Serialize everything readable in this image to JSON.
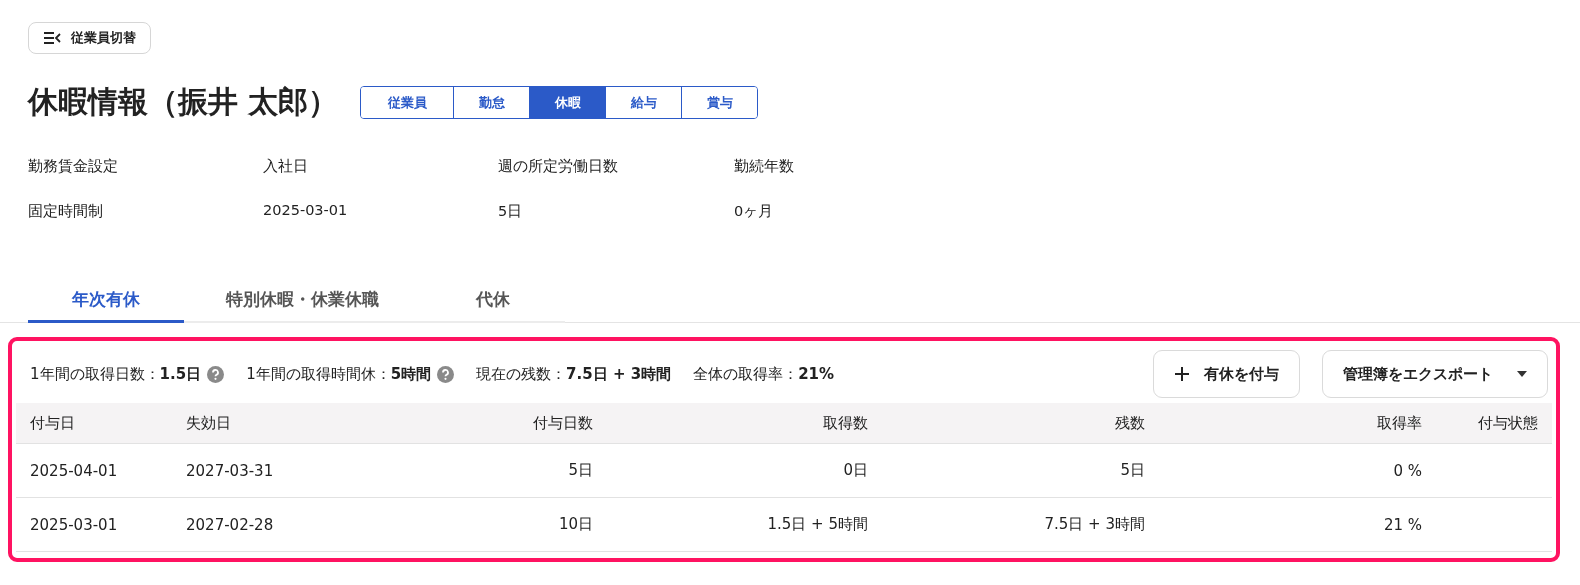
{
  "switch_button": {
    "label": "従業員切替"
  },
  "page_title": "休暇情報（振井 太郎）",
  "section_tabs": [
    {
      "label": "従業員",
      "selected": false
    },
    {
      "label": "勤怠",
      "selected": false
    },
    {
      "label": "休暇",
      "selected": true
    },
    {
      "label": "給与",
      "selected": false
    },
    {
      "label": "賞与",
      "selected": false
    }
  ],
  "info": [
    {
      "label": "勤務賃金設定",
      "value": "固定時間制"
    },
    {
      "label": "入社日",
      "value": "2025-03-01"
    },
    {
      "label": "週の所定労働日数",
      "value": "5日"
    },
    {
      "label": "勤続年数",
      "value": "0ヶ月"
    }
  ],
  "leave_tabs": [
    {
      "label": "年次有休",
      "selected": true
    },
    {
      "label": "特別休暇・休業休職",
      "selected": false
    },
    {
      "label": "代休",
      "selected": false
    }
  ],
  "summary": [
    {
      "text": "1年間の取得日数：**1.5日**",
      "help": true
    },
    {
      "text": "1年間の取得時間休：**5時間**",
      "help": true
    },
    {
      "text": "現在の残数：**7.5日 + 3時間**",
      "help": false
    },
    {
      "text": "全体の取得率：**21%**",
      "help": false
    }
  ],
  "grant_button": {
    "label": "有休を付与"
  },
  "export_button": {
    "label": "管理簿をエクスポート"
  },
  "table": {
    "columns": [
      "付与日",
      "失効日",
      "付与日数",
      "取得数",
      "残数",
      "取得率",
      "付与状態"
    ],
    "rows": [
      [
        "2025-04-01",
        "2027-03-31",
        "5日",
        "0日",
        "5日",
        "0 %"
      ],
      [
        "2025-03-01",
        "2027-02-28",
        "10日",
        "1.5日 + 5時間",
        "7.5日 + 3時間",
        "21 %"
      ]
    ]
  }
}
